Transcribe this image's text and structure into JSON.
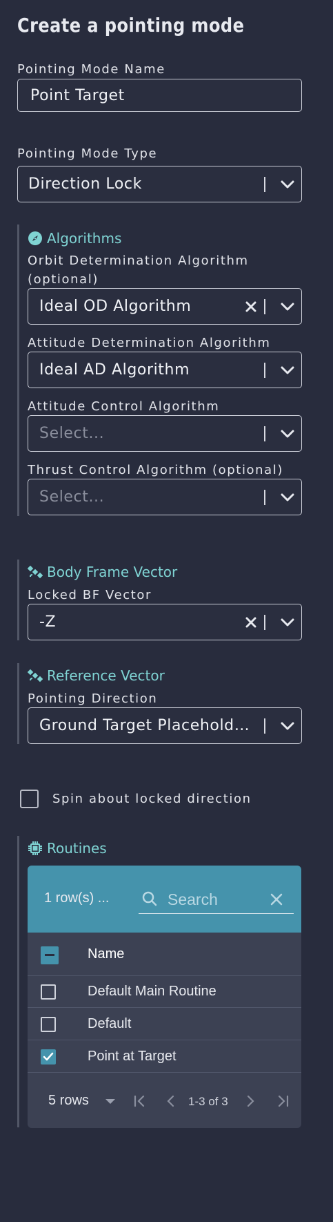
{
  "page": {
    "title": "Create a pointing mode"
  },
  "pointing_mode_name": {
    "label": "Pointing Mode Name",
    "value": "Point Target"
  },
  "pointing_mode_type": {
    "label": "Pointing Mode Type",
    "value": "Direction Lock"
  },
  "algorithms": {
    "title": "Algorithms",
    "orbit_determination": {
      "label_line1": "Orbit Determination Algorithm",
      "label_line2": "(optional)",
      "value": "Ideal OD Algorithm"
    },
    "attitude_determination": {
      "label": "Attitude Determination Algorithm",
      "value": "Ideal AD Algorithm"
    },
    "attitude_control": {
      "label": "Attitude Control Algorithm",
      "placeholder": "Select..."
    },
    "thrust_control": {
      "label": "Thrust Control Algorithm (optional)",
      "placeholder": "Select..."
    }
  },
  "body_frame_vector": {
    "title": "Body Frame Vector",
    "label": "Locked BF Vector",
    "value": "-Z"
  },
  "reference_vector": {
    "title": "Reference Vector",
    "label": "Pointing Direction",
    "value": "Ground Target Placeholder..."
  },
  "spin": {
    "label": "Spin about locked direction",
    "checked": false
  },
  "routines": {
    "title": "Routines",
    "selection_summary": "1 row(s) ...",
    "search_placeholder": "Search",
    "column_name": "Name",
    "rows": [
      {
        "name": "Default Main Routine",
        "checked": false
      },
      {
        "name": "Default",
        "checked": false
      },
      {
        "name": "Point at Target",
        "checked": true
      }
    ],
    "rows_per_page": "5 rows",
    "page_range": "1-3 of 3"
  },
  "colors": {
    "background": "#282c3d",
    "accent": "#7fd3d3",
    "table_header": "#4593ac",
    "table_body": "#3c4153"
  }
}
